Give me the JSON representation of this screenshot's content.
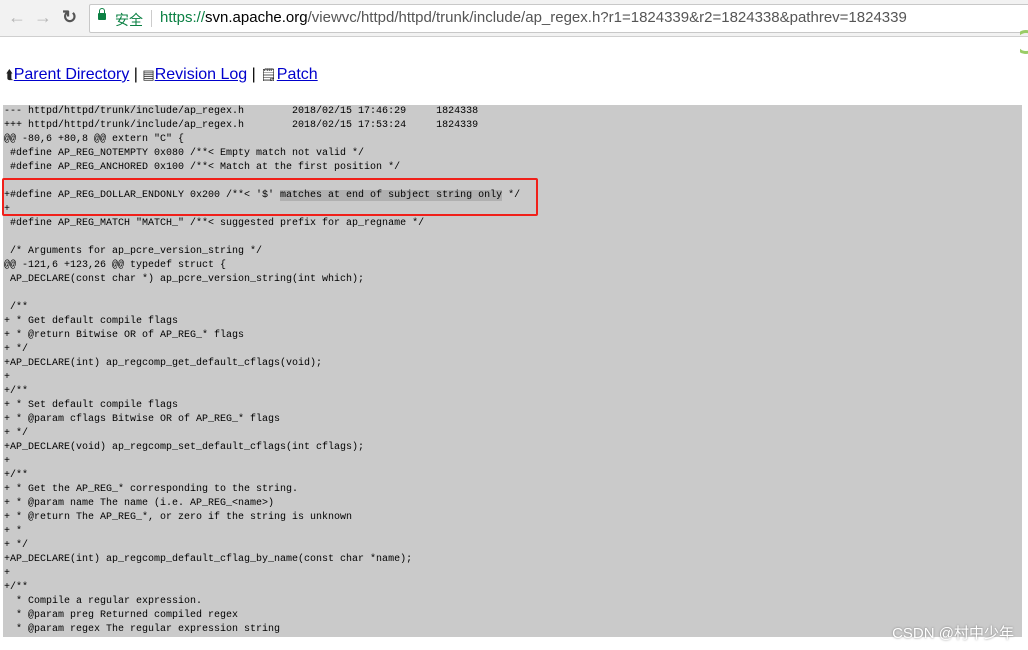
{
  "browser": {
    "secure_label": "安全",
    "url_scheme": "https://",
    "url_host": "svn.apache.org",
    "url_path": "/viewvc/httpd/httpd/trunk/include/ap_regex.h?r1=1824339&r2=1824338&pathrev=1824339"
  },
  "nav_links": {
    "parent_directory": "Parent Directory",
    "revision_log": "Revision Log",
    "patch": "Patch",
    "separator": "|"
  },
  "diff": {
    "lines": [
      "--- httpd/httpd/trunk/include/ap_regex.h        2018/02/15 17:46:29     1824338",
      "+++ httpd/httpd/trunk/include/ap_regex.h        2018/02/15 17:53:24     1824339",
      "@@ -80,6 +80,8 @@ extern \"C\" {",
      " #define AP_REG_NOTEMPTY 0x080 /**< Empty match not valid */",
      " #define AP_REG_ANCHORED 0x100 /**< Match at the first position */",
      "",
      "+#define AP_REG_DOLLAR_ENDONLY 0x200 /**< '$' ",
      "+",
      " #define AP_REG_MATCH \"MATCH_\" /**< suggested prefix for ap_regname */",
      "",
      " /* Arguments for ap_pcre_version_string */",
      "@@ -121,6 +123,26 @@ typedef struct {",
      " AP_DECLARE(const char *) ap_pcre_version_string(int which);",
      "",
      " /**",
      "+ * Get default compile flags",
      "+ * @return Bitwise OR of AP_REG_* flags",
      "+ */",
      "+AP_DECLARE(int) ap_regcomp_get_default_cflags(void);",
      "+",
      "+/**",
      "+ * Set default compile flags",
      "+ * @param cflags Bitwise OR of AP_REG_* flags",
      "+ */",
      "+AP_DECLARE(void) ap_regcomp_set_default_cflags(int cflags);",
      "+",
      "+/**",
      "+ * Get the AP_REG_* corresponding to the string.",
      "+ * @param name The name (i.e. AP_REG_<name>)",
      "+ * @return The AP_REG_*, or zero if the string is unknown",
      "+ *",
      "+ */",
      "+AP_DECLARE(int) ap_regcomp_default_cflag_by_name(const char *name);",
      "+",
      "+/**",
      "  * Compile a regular expression.",
      "  * @param preg Returned compiled regex",
      "  * @param regex The regular expression string"
    ],
    "highlighted_line_index": 6,
    "highlighted_text": "matches at end of subject string only",
    "highlighted_suffix": " */"
  },
  "watermark": "CSDN @村中少年",
  "colors": {
    "link": "#0000cc",
    "secure": "#0b8043",
    "diff_bg": "#cacaca",
    "annotation_box": "#f0201a"
  }
}
